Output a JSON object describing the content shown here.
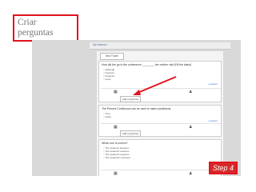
{
  "heading": "Criar perguntas",
  "step_label": "Step 4",
  "quiz_tab": "My Assess ›",
  "top_button": "New Folder",
  "questions": [
    {
      "text": "How did the go to the conference ________ her mother visit (Fill the blank)",
      "options": [
        "although",
        "however",
        "because",
        "since"
      ],
      "answer_link": "+ Answer",
      "add_label": "Add to Quizzes"
    },
    {
      "text": "The Present Continuous can be used to make predictions.",
      "options": [
        "True",
        "False"
      ],
      "answer_link": "+ Answer",
      "add_label": "Add to Quizzes"
    },
    {
      "text": "Which one is correct?",
      "options": [
        "The students answers",
        "The students' answers",
        "The student's answers",
        "The students'z answers"
      ],
      "answer_link": "",
      "add_label": ""
    }
  ],
  "colors": {
    "highlight": "#e2131f",
    "step_bg": "#d42a2a"
  }
}
